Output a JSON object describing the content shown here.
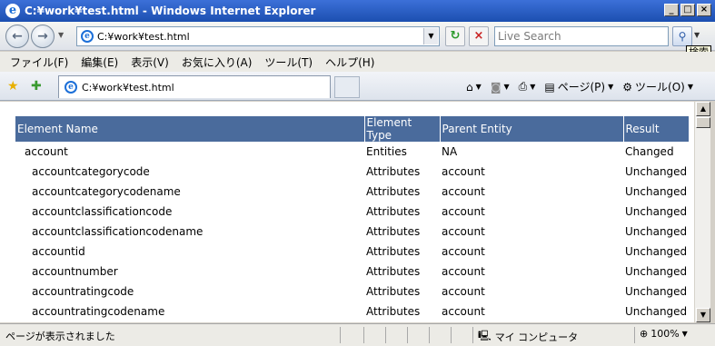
{
  "window": {
    "title": "C:¥work¥test.html - Windows Internet Explorer"
  },
  "address": {
    "url": "C:¥work¥test.html"
  },
  "search": {
    "placeholder": "Live Search",
    "tooltip": "検索"
  },
  "menu": [
    "ファイル(F)",
    "編集(E)",
    "表示(V)",
    "お気に入り(A)",
    "ツール(T)",
    "ヘルプ(H)"
  ],
  "tab": {
    "title": "C:¥work¥test.html"
  },
  "commands": {
    "page": "ページ(P)",
    "tools": "ツール(O)"
  },
  "table": {
    "headers": [
      "Element Name",
      "Element Type",
      "Parent Entity",
      "Result"
    ],
    "rows": [
      [
        "account",
        "Entities",
        "NA",
        "Changed"
      ],
      [
        "accountcategorycode",
        "Attributes",
        "account",
        "Unchanged"
      ],
      [
        "accountcategorycodename",
        "Attributes",
        "account",
        "Unchanged"
      ],
      [
        "accountclassificationcode",
        "Attributes",
        "account",
        "Unchanged"
      ],
      [
        "accountclassificationcodename",
        "Attributes",
        "account",
        "Unchanged"
      ],
      [
        "accountid",
        "Attributes",
        "account",
        "Unchanged"
      ],
      [
        "accountnumber",
        "Attributes",
        "account",
        "Unchanged"
      ],
      [
        "accountratingcode",
        "Attributes",
        "account",
        "Unchanged"
      ],
      [
        "accountratingcodename",
        "Attributes",
        "account",
        "Unchanged"
      ]
    ]
  },
  "status": {
    "text": "ページが表示されました",
    "zone": "マイ コンピュータ",
    "zoom": "100%"
  },
  "colors": {
    "header_bg": "#4a6b9c",
    "title_bar": "#1c4fb0"
  }
}
